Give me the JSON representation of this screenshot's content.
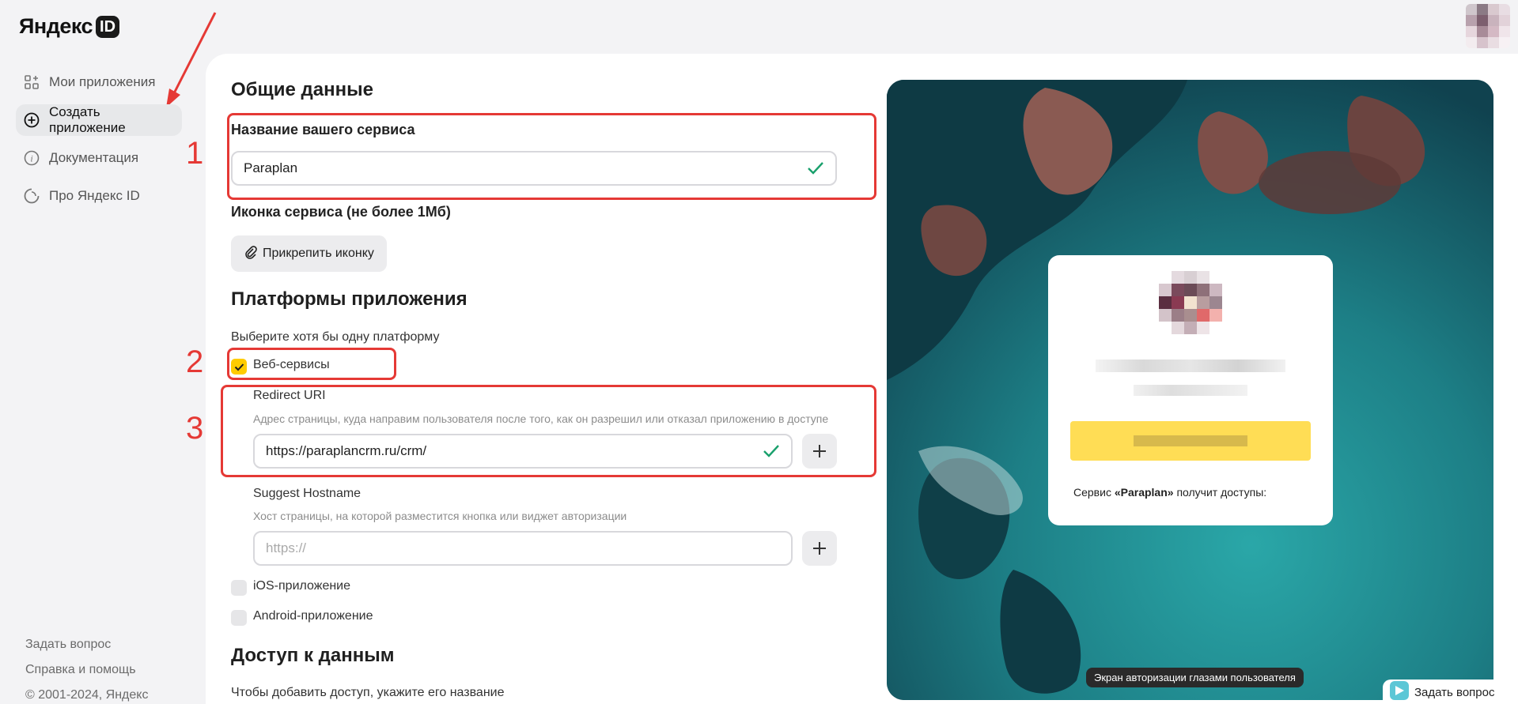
{
  "header": {
    "logo_text": "Яндекс",
    "logo_badge": "ID"
  },
  "sidebar": {
    "items": [
      {
        "label": "Мои приложения",
        "icon": "apps-icon"
      },
      {
        "label": "Создать приложение",
        "icon": "plus-circle-icon",
        "active": true
      },
      {
        "label": "Документация",
        "icon": "info-icon"
      },
      {
        "label": "Про Яндекс ID",
        "icon": "spinner-icon"
      }
    ],
    "footer": {
      "ask": "Задать вопрос",
      "help": "Справка и помощь",
      "copyright": "© 2001-2024, Яндекс"
    }
  },
  "form": {
    "general_title": "Общие данные",
    "service_name_label": "Название вашего сервиса",
    "service_name_value": "Paraplan",
    "icon_label": "Иконка сервиса (не более 1Мб)",
    "attach_button": "Прикрепить иконку",
    "platforms_title": "Платформы приложения",
    "platforms_hint": "Выберите хотя бы одну платформу",
    "web_label": "Веб-сервисы",
    "redirect_label": "Redirect URI",
    "redirect_hint": "Адрес страницы, куда направим пользователя после того, как он разрешил или отказал приложению в доступе",
    "redirect_value": "https://paraplancrm.ru/crm/",
    "suggest_label": "Suggest Hostname",
    "suggest_hint": "Хост страницы, на которой разместится кнопка или виджет авторизации",
    "suggest_placeholder": "https://",
    "ios_label": "iOS-приложение",
    "android_label": "Android-приложение",
    "access_title": "Доступ к данным",
    "access_hint": "Чтобы добавить доступ, укажите его название"
  },
  "annotations": {
    "n1": "1",
    "n2": "2",
    "n3": "3"
  },
  "preview": {
    "access_prefix": "Сервис ",
    "access_service": "«Paraplan»",
    "access_suffix": " получит доступы:",
    "caption": "Экран авторизации глазами пользователя"
  },
  "chat": {
    "ask_label": "Задать вопрос"
  },
  "colors": {
    "accent": "#ffcc00",
    "annotation": "#e53935",
    "success": "#19a06c"
  }
}
